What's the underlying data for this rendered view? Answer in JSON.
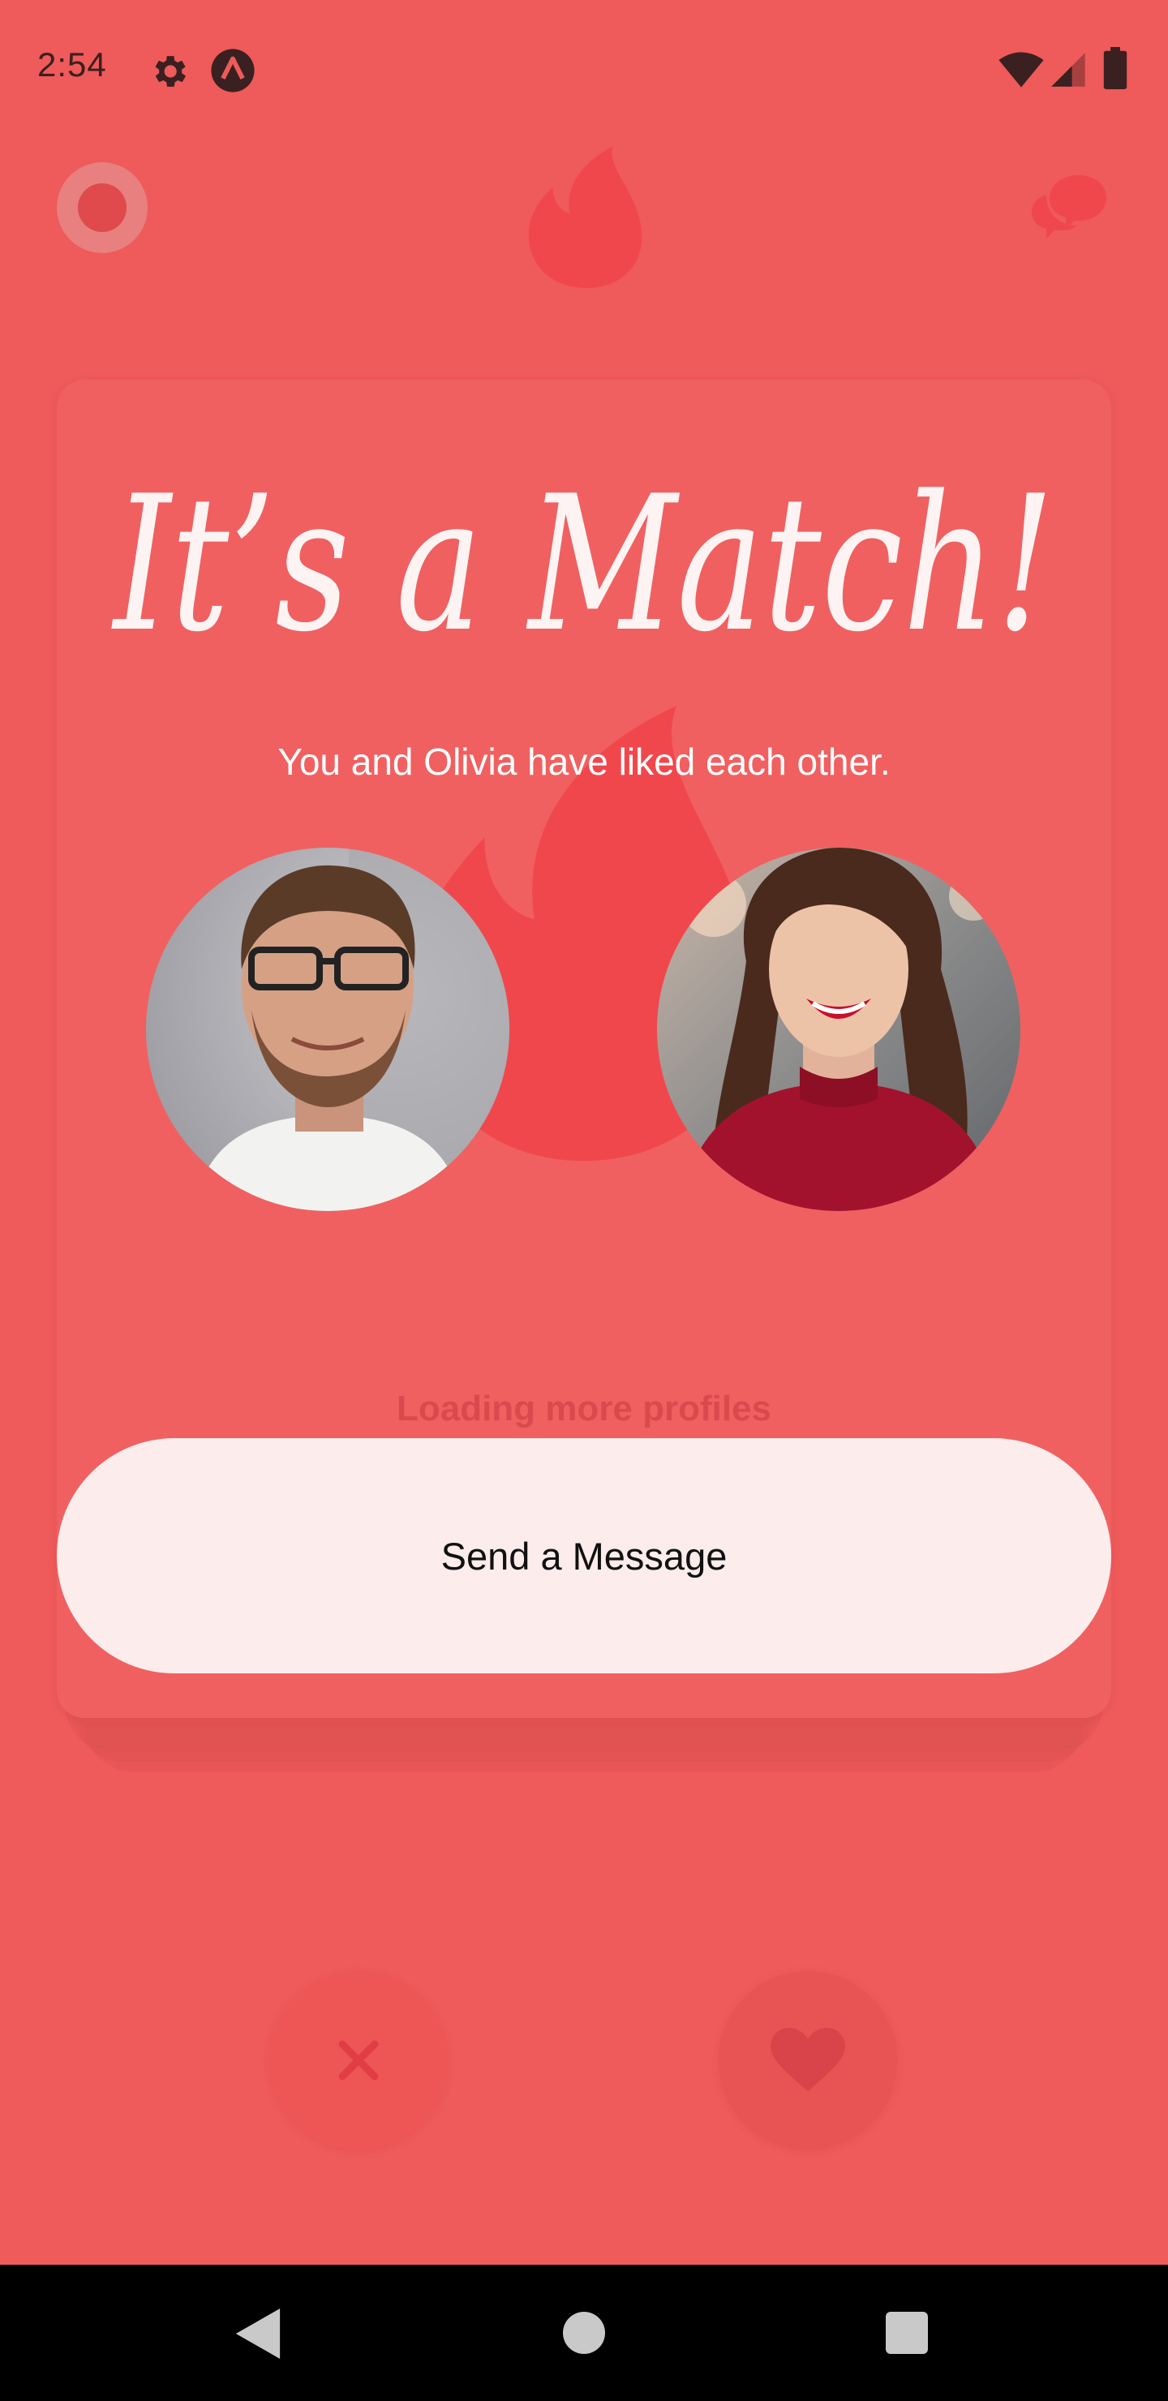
{
  "status_bar": {
    "time": "2:54",
    "icons": [
      "gear-icon",
      "app-icon",
      "wifi-icon",
      "signal-icon",
      "battery-icon"
    ]
  },
  "top_nav": {
    "icons": [
      "profile-icon",
      "flame-logo-icon",
      "chat-icon"
    ]
  },
  "match": {
    "title": "It’s a Match!",
    "subtitle": "You and Olivia  have liked each other.",
    "avatars": [
      "user-avatar",
      "match-avatar"
    ]
  },
  "loading": {
    "text": "Loading more profiles"
  },
  "actions": {
    "send_message_label": "Send a Message",
    "dislike_icon": "close-icon",
    "like_icon": "heart-icon"
  },
  "colors": {
    "background": "#ef5a5a",
    "flame": "#f0474d",
    "button_bg": "#fcecec",
    "title": "#fdf3f3"
  }
}
